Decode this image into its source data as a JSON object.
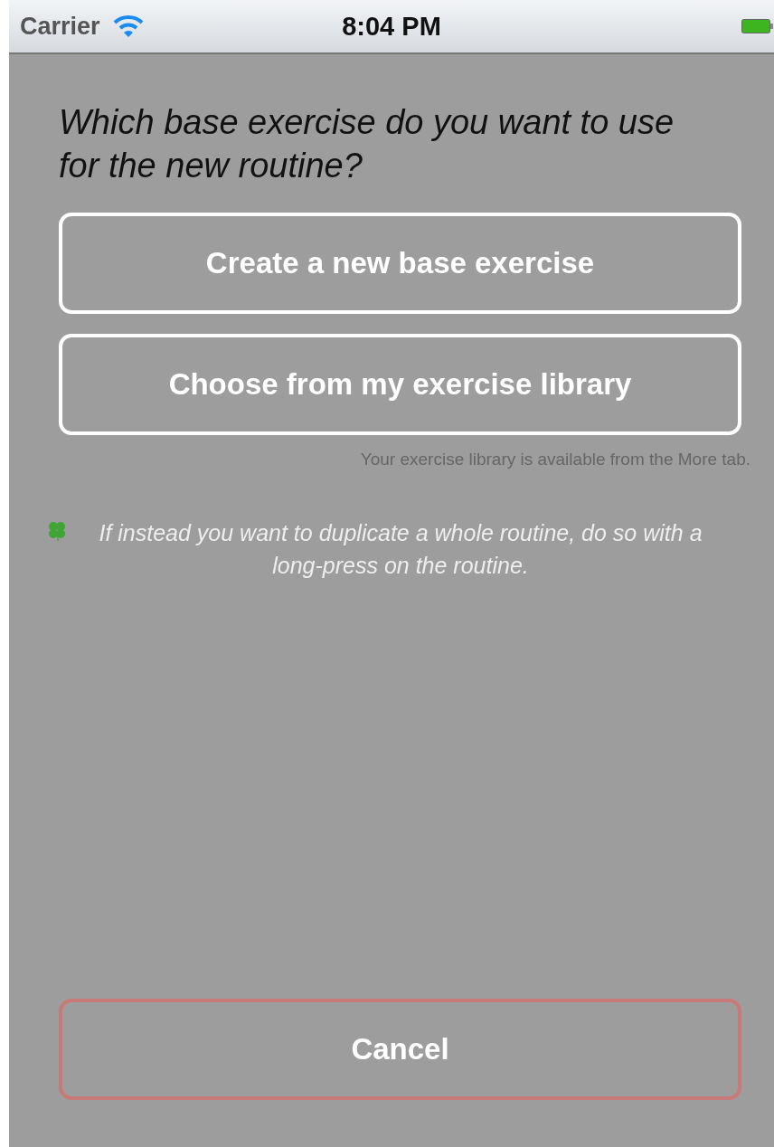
{
  "status_bar": {
    "carrier": "Carrier",
    "time": "8:04 PM"
  },
  "question": "Which base exercise do you want to use for the new routine?",
  "options": [
    {
      "label": "Create a new base exercise",
      "kind": "default"
    },
    {
      "label": "Choose from my exercise library",
      "kind": "default"
    }
  ],
  "library_note": "Your exercise library is available from the More tab.",
  "tip": "If instead you want to duplicate a whole routine, do so with a long-press on the routine.",
  "cancel": {
    "label": "Cancel",
    "kind": "cancel"
  }
}
